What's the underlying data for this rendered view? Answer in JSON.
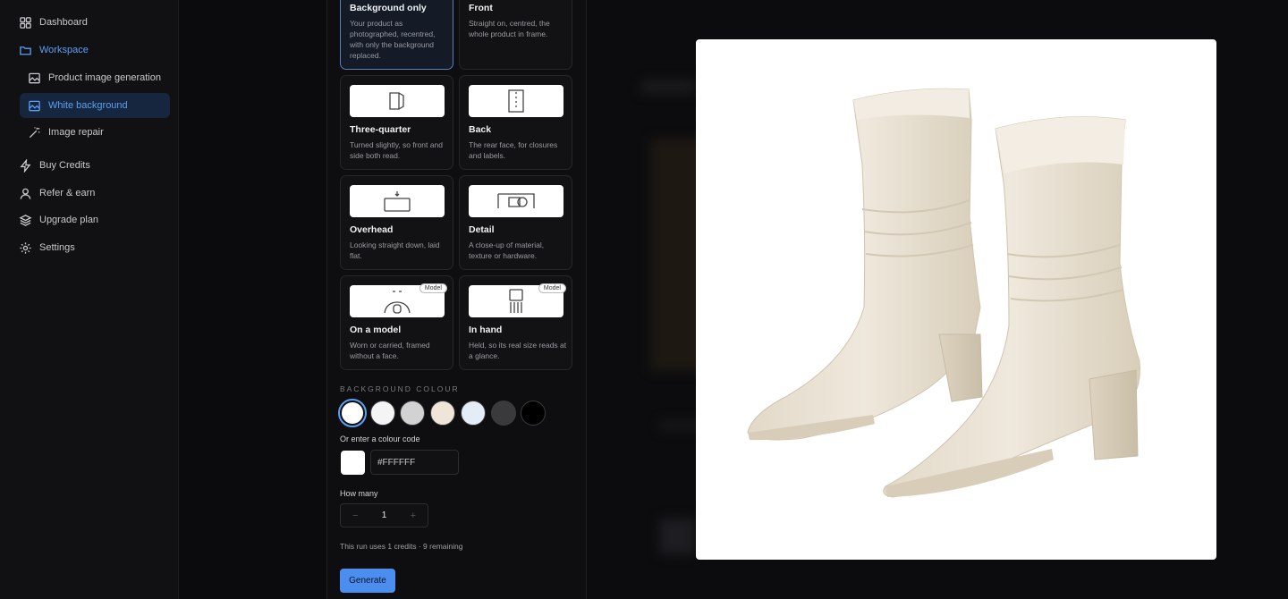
{
  "sidebar": {
    "items": [
      {
        "label": "Dashboard",
        "icon": "grid-icon"
      },
      {
        "label": "Workspace",
        "icon": "folder-icon"
      },
      {
        "label": "Product image generation",
        "icon": "image-icon"
      },
      {
        "label": "White background",
        "icon": "image-icon"
      },
      {
        "label": "Image repair",
        "icon": "magic-wand-icon"
      },
      {
        "label": "Buy Credits",
        "icon": "lightning-icon"
      },
      {
        "label": "Refer & earn",
        "icon": "user-icon"
      },
      {
        "label": "Upgrade plan",
        "icon": "layers-icon"
      },
      {
        "label": "Settings",
        "icon": "gear-icon"
      }
    ],
    "active_item": "White background"
  },
  "views": [
    {
      "title": "Background only",
      "desc": "Your product as photographed, recentred, with only the background replaced.",
      "selected": true
    },
    {
      "title": "Front",
      "desc": "Straight on, centred, the whole product in frame."
    },
    {
      "title": "Three-quarter",
      "desc": "Turned slightly, so front and side both read."
    },
    {
      "title": "Back",
      "desc": "The rear face, for closures and labels."
    },
    {
      "title": "Overhead",
      "desc": "Looking straight down, laid flat."
    },
    {
      "title": "Detail",
      "desc": "A close-up of material, texture or hardware."
    },
    {
      "title": "On a model",
      "desc": "Worn or carried, framed without a face.",
      "badge": "Model"
    },
    {
      "title": "In hand",
      "desc": "Held, so its real size reads at a glance.",
      "badge": "Model"
    }
  ],
  "background_colour": {
    "label": "BACKGROUND COLOUR",
    "swatches": [
      "#ffffff",
      "#f4f4f4",
      "#d2d2d2",
      "#efe6d8",
      "#e4ecf5",
      "#3a3a3c",
      "#000000"
    ],
    "selected": "#ffffff",
    "code_label": "Or enter a colour code",
    "code_value": "#FFFFFF"
  },
  "how_many": {
    "label": "How many",
    "value": "1",
    "minus": "−",
    "plus": "+"
  },
  "credits_hint": "This run uses 1 credits · 9 remaining",
  "generate_label": "Generate"
}
